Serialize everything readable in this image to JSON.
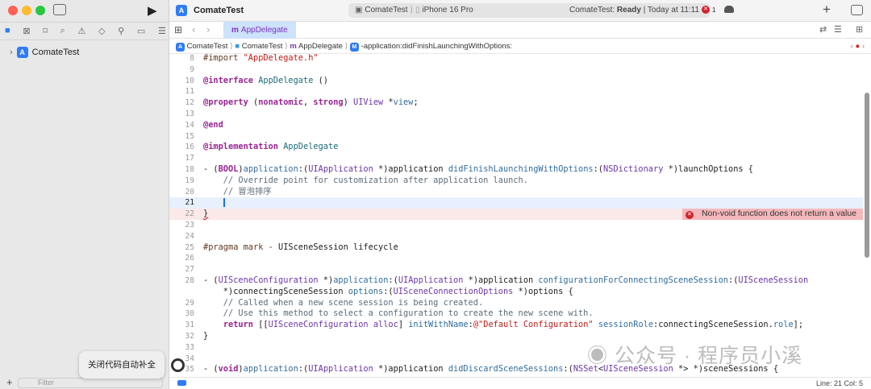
{
  "window": {
    "title": "ComateTest"
  },
  "activity": {
    "scheme": "ComateTest",
    "device": "iPhone 16 Pro",
    "status_project": "ComateTest:",
    "status_state": "Ready",
    "status_time": "| Today at 11:11",
    "error_count": "1"
  },
  "navigator": {
    "root_item": "ComateTest",
    "filter_placeholder": "Filter"
  },
  "tab": {
    "label": "AppDelegate"
  },
  "breadcrumbs": [
    "ComateTest",
    "ComateTest",
    "AppDelegate",
    "-application:didFinishLaunchingWithOptions:"
  ],
  "code": [
    {
      "n": "8",
      "t": [
        [
          "#import ",
          "pp"
        ],
        [
          "\"AppDelegate.h\"",
          "str"
        ]
      ]
    },
    {
      "n": "9",
      "t": []
    },
    {
      "n": "10",
      "t": [
        [
          "@interface ",
          "kw"
        ],
        [
          "AppDelegate",
          "cls"
        ],
        [
          " ()",
          "plain"
        ]
      ]
    },
    {
      "n": "11",
      "t": []
    },
    {
      "n": "12",
      "t": [
        [
          "@property ",
          "kw"
        ],
        [
          "(",
          "plain"
        ],
        [
          "nonatomic",
          "kw"
        ],
        [
          ", ",
          "plain"
        ],
        [
          "strong",
          "kw"
        ],
        [
          ") ",
          "plain"
        ],
        [
          "UIView",
          "type"
        ],
        [
          " *",
          "plain"
        ],
        [
          "view",
          "fn"
        ],
        [
          ";",
          "plain"
        ]
      ]
    },
    {
      "n": "13",
      "t": []
    },
    {
      "n": "14",
      "t": [
        [
          "@end",
          "kw"
        ]
      ]
    },
    {
      "n": "15",
      "t": []
    },
    {
      "n": "16",
      "t": [
        [
          "@implementation ",
          "kw"
        ],
        [
          "AppDelegate",
          "cls"
        ]
      ]
    },
    {
      "n": "17",
      "t": []
    },
    {
      "n": "18",
      "t": [
        [
          "- (",
          "plain"
        ],
        [
          "BOOL",
          "kw"
        ],
        [
          ")",
          "plain"
        ],
        [
          "application",
          "fn"
        ],
        [
          ":(",
          "plain"
        ],
        [
          "UIApplication",
          "type"
        ],
        [
          " *)application ",
          "plain"
        ],
        [
          "didFinishLaunchingWithOptions",
          "fn"
        ],
        [
          ":(",
          "plain"
        ],
        [
          "NSDictionary",
          "type"
        ],
        [
          " *)launchOptions {",
          "plain"
        ]
      ]
    },
    {
      "n": "19",
      "t": [
        [
          "    // Override point for customization after application launch.",
          "cm"
        ]
      ]
    },
    {
      "n": "20",
      "t": [
        [
          "    // 冒泡排序",
          "cm"
        ]
      ]
    },
    {
      "n": "21",
      "t": [
        [
          "    ",
          "plain"
        ]
      ],
      "current": true
    },
    {
      "n": "22",
      "t": [
        [
          "}",
          "plain"
        ]
      ],
      "error": "Non-void function does not return a value"
    },
    {
      "n": "23",
      "t": []
    },
    {
      "n": "24",
      "t": []
    },
    {
      "n": "25",
      "t": [
        [
          "#pragma mark - ",
          "pp"
        ],
        [
          "UISceneSession lifecycle",
          "plain"
        ]
      ]
    },
    {
      "n": "26",
      "t": []
    },
    {
      "n": "27",
      "t": []
    },
    {
      "n": "28",
      "t": [
        [
          "- (",
          "plain"
        ],
        [
          "UISceneConfiguration",
          "type"
        ],
        [
          " *)",
          "plain"
        ],
        [
          "application",
          "fn"
        ],
        [
          ":(",
          "plain"
        ],
        [
          "UIApplication",
          "type"
        ],
        [
          " *)application ",
          "plain"
        ],
        [
          "configurationForConnectingSceneSession",
          "fn"
        ],
        [
          ":(",
          "plain"
        ],
        [
          "UISceneSession",
          "type"
        ]
      ]
    },
    {
      "n": "",
      "t": [
        [
          "    *)connectingSceneSession ",
          "plain"
        ],
        [
          "options",
          "fn"
        ],
        [
          ":(",
          "plain"
        ],
        [
          "UISceneConnectionOptions",
          "type"
        ],
        [
          " *)options {",
          "plain"
        ]
      ]
    },
    {
      "n": "29",
      "t": [
        [
          "    // Called when a new scene session is being created.",
          "cm"
        ]
      ]
    },
    {
      "n": "30",
      "t": [
        [
          "    // Use this method to select a configuration to create the new scene with.",
          "cm"
        ]
      ]
    },
    {
      "n": "31",
      "t": [
        [
          "    ",
          "plain"
        ],
        [
          "return",
          "kw"
        ],
        [
          " [[",
          "plain"
        ],
        [
          "UISceneConfiguration",
          "type"
        ],
        [
          " ",
          "plain"
        ],
        [
          "alloc",
          "type"
        ],
        [
          "] ",
          "plain"
        ],
        [
          "initWithName",
          "fn"
        ],
        [
          ":",
          "plain"
        ],
        [
          "@\"Default Configuration\"",
          "str"
        ],
        [
          " ",
          "plain"
        ],
        [
          "sessionRole",
          "fn"
        ],
        [
          ":connectingSceneSession.",
          "plain"
        ],
        [
          "role",
          "fn"
        ],
        [
          "];",
          "plain"
        ]
      ]
    },
    {
      "n": "32",
      "t": [
        [
          "}",
          "plain"
        ]
      ]
    },
    {
      "n": "33",
      "t": []
    },
    {
      "n": "34",
      "t": []
    },
    {
      "n": "35",
      "t": [
        [
          "- (",
          "plain"
        ],
        [
          "void",
          "kw"
        ],
        [
          ")",
          "plain"
        ],
        [
          "application",
          "fn"
        ],
        [
          ":(",
          "plain"
        ],
        [
          "UIApplication",
          "type"
        ],
        [
          " *)application ",
          "plain"
        ],
        [
          "didDiscardSceneSessions",
          "fn"
        ],
        [
          ":(",
          "plain"
        ],
        [
          "NSSet",
          "type"
        ],
        [
          "<",
          "plain"
        ],
        [
          "UISceneSession",
          "type"
        ],
        [
          " *> *)sceneSessions {",
          "plain"
        ]
      ]
    }
  ],
  "status": {
    "position": "Line: 21  Col: 5"
  },
  "tooltip": {
    "text": "关闭代码自动补全"
  },
  "watermark": {
    "text": "公众号 · 程序员小溪"
  },
  "colors": {
    "accent": "#2f7cf6",
    "error": "#d2232a",
    "error_bg": "#f4b7bb",
    "current_line": "#e8f0fd"
  }
}
